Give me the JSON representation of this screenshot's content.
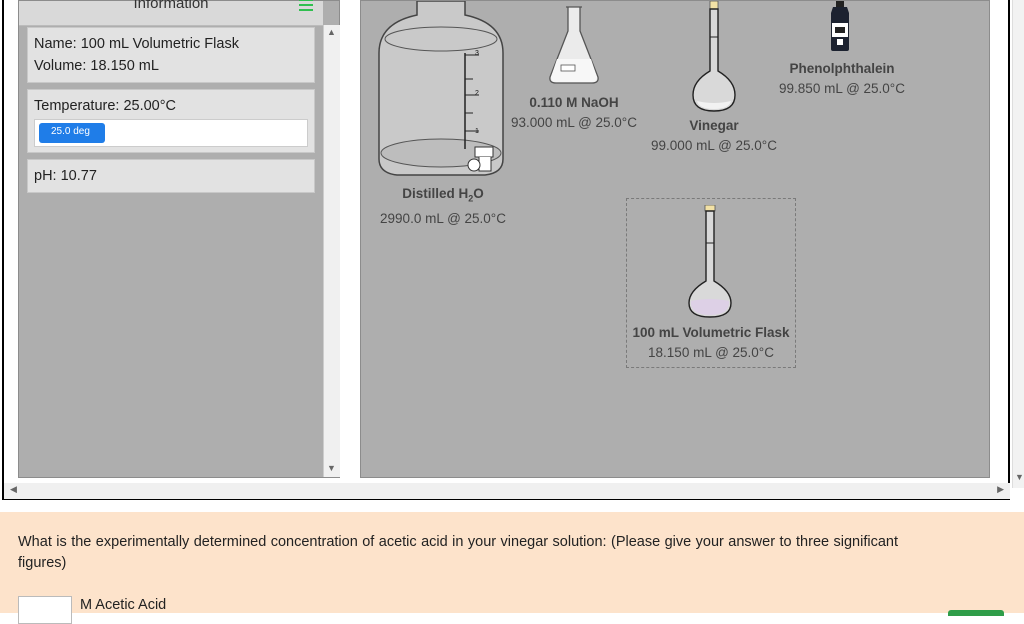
{
  "info_panel": {
    "title": "Information",
    "name_line": "Name: 100 mL Volumetric Flask",
    "volume_line": "Volume: 18.150 mL",
    "temperature_line": "Temperature: 25.00°C",
    "temperature_bar_label": "25.0 deg",
    "temperature_bar_fraction": 0.25,
    "ph_line": "pH: 10.77"
  },
  "workbench": {
    "items": [
      {
        "id": "distilled-water",
        "name_pre": "Distilled H",
        "name_sub": "2",
        "name_post": "O",
        "detail": "2990.0 mL @ 25.0°C"
      },
      {
        "id": "naoh",
        "name": "0.110 M NaOH",
        "detail": "93.000 mL @ 25.0°C"
      },
      {
        "id": "vinegar",
        "name": "Vinegar",
        "detail": "99.000 mL @ 25.0°C"
      },
      {
        "id": "phenolphthalein",
        "name": "Phenolphthalein",
        "detail": "99.850 mL @ 25.0°C"
      },
      {
        "id": "volumetric-flask",
        "name": "100 mL Volumetric Flask",
        "detail": "18.150 mL @ 25.0°C"
      }
    ],
    "carboy_marks": [
      "3",
      "2",
      "1"
    ]
  },
  "question": {
    "text": "What is the experimentally determined concentration of acetic acid in your vinegar solution: (Please give your answer to three significant figures)",
    "answer_value": "",
    "answer_unit": "M Acetic Acid"
  },
  "colors": {
    "panel_bg": "#aeaeae",
    "temp_bar": "#1f7de8",
    "menu_icon": "#2fbf4f",
    "question_bg": "#fde3cb"
  }
}
